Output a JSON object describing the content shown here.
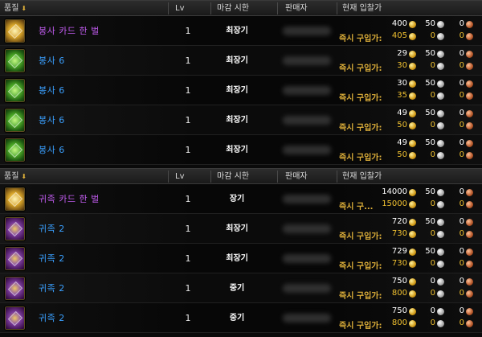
{
  "headers": {
    "quality": "품질",
    "lv": "Lv",
    "deadline": "마감 시한",
    "seller": "판매자",
    "current_bid": "현재 입찰가"
  },
  "instant_label": "즉시 구입가:",
  "instant_label_short": "즉시 구...",
  "tables": [
    {
      "rows": [
        {
          "name": "봉사 카드 한 벌",
          "name_color": "purple",
          "card": "gold",
          "lv": "1",
          "deadline": "최장기",
          "bid": {
            "gold": "400",
            "silver": "50",
            "copper": "0"
          },
          "buyout": {
            "gold": "405",
            "silver": "0",
            "copper": "0"
          }
        },
        {
          "name": "봉사 6",
          "name_color": "blue",
          "card": "green",
          "lv": "1",
          "deadline": "최장기",
          "bid": {
            "gold": "29",
            "silver": "50",
            "copper": "0"
          },
          "buyout": {
            "gold": "30",
            "silver": "0",
            "copper": "0"
          }
        },
        {
          "name": "봉사 6",
          "name_color": "blue",
          "card": "green",
          "lv": "1",
          "deadline": "최장기",
          "bid": {
            "gold": "30",
            "silver": "50",
            "copper": "0"
          },
          "buyout": {
            "gold": "35",
            "silver": "0",
            "copper": "0"
          }
        },
        {
          "name": "봉사 6",
          "name_color": "blue",
          "card": "green",
          "lv": "1",
          "deadline": "최장기",
          "bid": {
            "gold": "49",
            "silver": "50",
            "copper": "0"
          },
          "buyout": {
            "gold": "50",
            "silver": "0",
            "copper": "0"
          }
        },
        {
          "name": "봉사 6",
          "name_color": "blue",
          "card": "green",
          "lv": "1",
          "deadline": "최장기",
          "bid": {
            "gold": "49",
            "silver": "50",
            "copper": "0"
          },
          "buyout": {
            "gold": "50",
            "silver": "0",
            "copper": "0"
          }
        }
      ]
    },
    {
      "rows": [
        {
          "name": "귀족 카드 한 벌",
          "name_color": "purple",
          "card": "gold",
          "lv": "1",
          "deadline": "장기",
          "bid": {
            "gold": "14000",
            "silver": "50",
            "copper": "0"
          },
          "buyout": {
            "gold": "15000",
            "silver": "0",
            "copper": "0"
          },
          "short_label": true
        },
        {
          "name": "귀족 2",
          "name_color": "blue",
          "card": "purple",
          "lv": "1",
          "deadline": "최장기",
          "bid": {
            "gold": "720",
            "silver": "50",
            "copper": "0"
          },
          "buyout": {
            "gold": "730",
            "silver": "0",
            "copper": "0"
          }
        },
        {
          "name": "귀족 2",
          "name_color": "blue",
          "card": "purple",
          "lv": "1",
          "deadline": "최장기",
          "bid": {
            "gold": "729",
            "silver": "50",
            "copper": "0"
          },
          "buyout": {
            "gold": "730",
            "silver": "0",
            "copper": "0"
          }
        },
        {
          "name": "귀족 2",
          "name_color": "blue",
          "card": "purple",
          "lv": "1",
          "deadline": "중기",
          "bid": {
            "gold": "750",
            "silver": "0",
            "copper": "0"
          },
          "buyout": {
            "gold": "800",
            "silver": "0",
            "copper": "0"
          }
        },
        {
          "name": "귀족 2",
          "name_color": "blue",
          "card": "purple",
          "lv": "1",
          "deadline": "중기",
          "bid": {
            "gold": "750",
            "silver": "0",
            "copper": "0"
          },
          "buyout": {
            "gold": "800",
            "silver": "0",
            "copper": "0"
          }
        }
      ]
    }
  ]
}
